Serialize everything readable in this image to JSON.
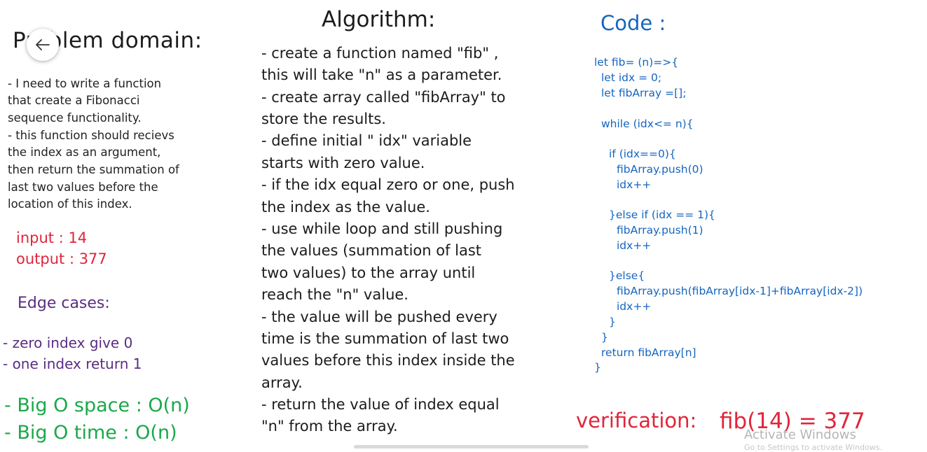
{
  "problem_domain": {
    "title": "Problem domain:",
    "lines": [
      "- I need to write a function",
      "that create a Fibonacci",
      "sequence functionality.",
      "- this function should recievs",
      "the index as an argument,",
      "then return the summation of",
      "last two values before the",
      "location of this index."
    ],
    "input": "input : 14",
    "output": "output : 377",
    "edge_title": "Edge cases:",
    "edge_cases": [
      "- zero index give 0",
      "- one index return 1"
    ],
    "big_o_space": "- Big O space : O(n)",
    "big_o_time": "- Big O time : O(n)"
  },
  "algorithm": {
    "title": "Algorithm:",
    "lines": [
      "- create a function named \"fib\" ,",
      "this will take \"n\" as a parameter.",
      "- create array called \"fibArray\" to",
      "store the results.",
      "- define initial \" idx\" variable",
      "starts with zero value.",
      "- if the idx equal zero or one, push",
      "the index as the value.",
      "- use while loop and still pushing",
      "the values (summation of last",
      "two values) to the array until",
      "reach the \"n\" value.",
      "- the value will be pushed every",
      "time is the summation of last two",
      "values before this index inside the",
      "array.",
      "- return the value of index equal",
      "\"n\" from the array."
    ]
  },
  "code": {
    "title": "Code :",
    "lines": [
      "let fib= (n)=>{",
      "let idx = 0;",
      "let fibArray =[];",
      "while (idx<= n){",
      "if (idx==0){",
      "fibArray.push(0)",
      "idx++",
      "}else if (idx == 1){",
      "fibArray.push(1)",
      "idx++",
      "}else{",
      "fibArray.push(fibArray[idx-1]+fibArray[idx-2])",
      "idx++",
      "}",
      "}",
      "return fibArray[n]",
      "}"
    ],
    "verification_label": "verification:",
    "verification_value": "fib(14) = 377"
  },
  "watermark": {
    "title": "Activate Windows",
    "subtitle": "Go to Settings to activate Windows."
  },
  "icons": {
    "back": "arrow-left-icon"
  }
}
